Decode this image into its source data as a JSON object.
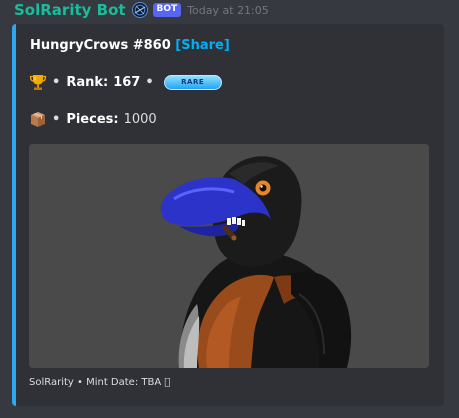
{
  "message": {
    "username": "SolRarity Bot",
    "bot_tag": "BOT",
    "timestamp": "Today at 21:05"
  },
  "embed": {
    "title_text": "HungryCrows #860",
    "share_label": "[Share]",
    "accent_color": "#2ea6f0",
    "rank": {
      "icon": "trophy-icon",
      "separator": "•",
      "label": "Rank:",
      "value": "167",
      "rarity_badge": "RARE"
    },
    "pieces": {
      "icon": "box-icon",
      "separator": "•",
      "label": "Pieces:",
      "value": "1000"
    },
    "image": {
      "subject": "crow-nft-image"
    },
    "footer": "SolRarity • Mint Date: TBA ⃠"
  }
}
